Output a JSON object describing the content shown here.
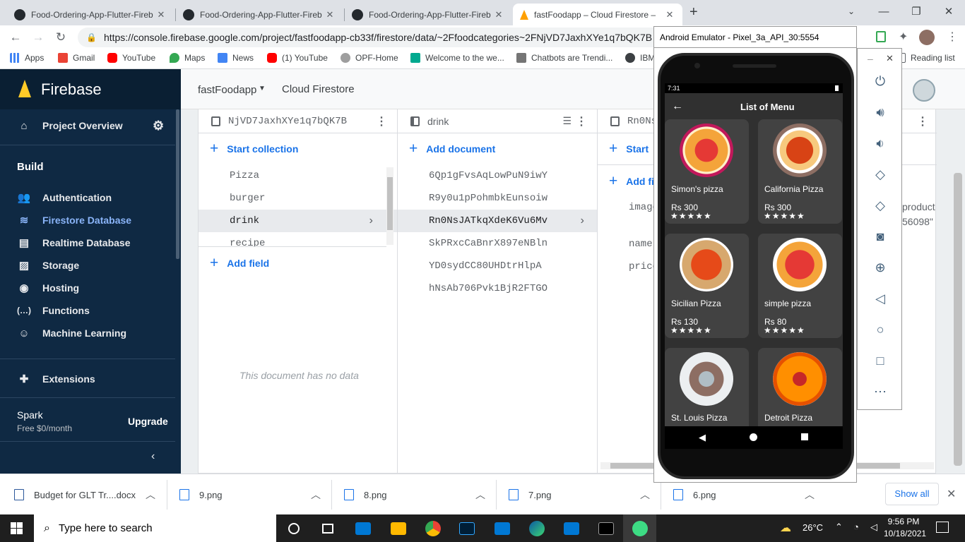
{
  "browser": {
    "tabs": [
      {
        "title": "Food-Ordering-App-Flutter-Fireb",
        "icon": "github-icon"
      },
      {
        "title": "Food-Ordering-App-Flutter-Fireb",
        "icon": "github-icon"
      },
      {
        "title": "Food-Ordering-App-Flutter-Fireb",
        "icon": "github-icon"
      },
      {
        "title": "fastFoodapp – Cloud Firestore –",
        "icon": "firebase-icon"
      }
    ],
    "new_tab": "+",
    "url": "https://console.firebase.google.com/project/fastfoodapp-cb33f/firestore/data/~2Ffoodcategories~2FNjVD7JaxhXYe1q7bQK7B",
    "bookmarks": [
      {
        "label": "Apps",
        "color": "#4285f4"
      },
      {
        "label": "Gmail",
        "color": "#ea4335"
      },
      {
        "label": "YouTube",
        "color": "#ff0000"
      },
      {
        "label": "Maps",
        "color": "#34a853"
      },
      {
        "label": "News",
        "color": "#4285f4"
      },
      {
        "label": "(1) YouTube",
        "color": "#ff0000"
      },
      {
        "label": "OPF-Home",
        "color": "#5f6368"
      },
      {
        "label": "Welcome to the we...",
        "color": "#00a98f"
      },
      {
        "label": "Chatbots are Trendi...",
        "color": "#5f6368"
      },
      {
        "label": "IBM",
        "color": "#3c4043"
      }
    ],
    "reading_list": "Reading list"
  },
  "firebase": {
    "brand": "Firebase",
    "project_overview": "Project Overview",
    "build_heading": "Build",
    "nav": [
      {
        "label": "Authentication",
        "icon": "users-icon",
        "glyph": "👥",
        "active": false
      },
      {
        "label": "Firestore Database",
        "icon": "firestore-icon",
        "glyph": "≋",
        "active": true
      },
      {
        "label": "Realtime Database",
        "icon": "database-icon",
        "glyph": "▤",
        "active": false
      },
      {
        "label": "Storage",
        "icon": "storage-icon",
        "glyph": "▨",
        "active": false
      },
      {
        "label": "Hosting",
        "icon": "globe-icon",
        "glyph": "◉",
        "active": false
      },
      {
        "label": "Functions",
        "icon": "functions-icon",
        "glyph": "(…)",
        "active": false
      },
      {
        "label": "Machine Learning",
        "icon": "robot-icon",
        "glyph": "☺",
        "active": false
      }
    ],
    "extensions": "Extensions",
    "plan_name": "Spark",
    "plan_price": "Free $0/month",
    "upgrade": "Upgrade",
    "project_name": "fastFoodapp",
    "product_name": "Cloud Firestore"
  },
  "firestore": {
    "col1": {
      "header": "NjVD7JaxhXYe1q7bQK7B",
      "start_collection": "Start collection",
      "items": [
        "Pizza",
        "burger",
        "drink",
        "recipe"
      ],
      "selected": 2,
      "add_field": "Add field",
      "empty_msg": "This document has no data"
    },
    "col2": {
      "header": "drink",
      "add_document": "Add document",
      "items": [
        "6Qp1gFvsAqLowPuN9iwY",
        "R9y0u1pPohmbkEunsoiw",
        "Rn0NsJATkqXdeK6Vu6Mv",
        "SkPRxcCaBnrX897eNBln",
        "YD0sydCC80UHDtrHlpA",
        "hNsAb706Pvk1BjR2FTGO"
      ],
      "selected": 2
    },
    "col3": {
      "header": "Rn0Ns",
      "start": "Start",
      "add": "Add fi",
      "fields": [
        "image",
        "name",
        "price"
      ],
      "overflow_right": [
        "product",
        "56098\""
      ]
    }
  },
  "downloads": [
    {
      "name": "Budget for GLT Tr....docx"
    },
    {
      "name": "9.png"
    },
    {
      "name": "8.png"
    },
    {
      "name": "7.png"
    },
    {
      "name": "6.png"
    }
  ],
  "downloads_show_all": "Show all",
  "taskbar": {
    "search_placeholder": "Type here to search",
    "temperature": "26°C",
    "time": "9:56 PM",
    "date": "10/18/2021"
  },
  "emulator": {
    "window_title": "Android Emulator - Pixel_3a_API_30:5554",
    "status_time": "7:31",
    "app_title": "List of Menu",
    "items": [
      {
        "name": "Simon's pizza",
        "price": "Rs 300",
        "stars": "★★★★★"
      },
      {
        "name": "California Pizza",
        "price": "Rs 300",
        "stars": "★★★★★"
      },
      {
        "name": "Sicilian Pizza",
        "price": "Rs 130",
        "stars": "★★★★★"
      },
      {
        "name": "simple pizza",
        "price": "Rs 80",
        "stars": "★★★★★"
      },
      {
        "name": "St. Louis Pizza",
        "price": "",
        "stars": ""
      },
      {
        "name": "Detroit Pizza",
        "price": "",
        "stars": ""
      }
    ]
  }
}
